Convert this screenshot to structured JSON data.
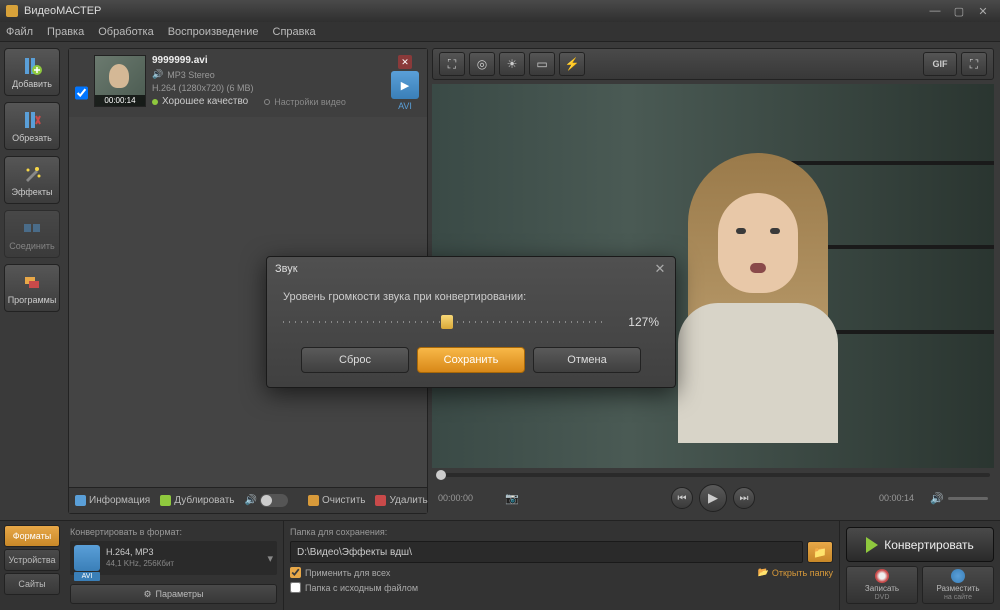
{
  "app_title": "ВидеоМАСТЕР",
  "menu": {
    "file": "Файл",
    "edit": "Правка",
    "process": "Обработка",
    "playback": "Воспроизведение",
    "help": "Справка"
  },
  "sidebar": {
    "add": "Добавить",
    "cut": "Обрезать",
    "effects": "Эффекты",
    "join": "Соединить",
    "programs": "Программы"
  },
  "file": {
    "name": "9999999.avi",
    "audio": "MP3 Stereo",
    "codec": "H.264 (1280x720) (6 MB)",
    "duration": "00:00:14",
    "quality": "Хорошее качество",
    "settings": "Настройки видео",
    "format": "AVI"
  },
  "list_actions": {
    "info": "Информация",
    "duplicate": "Дублировать",
    "clear": "Очистить",
    "delete": "Удалить"
  },
  "preview_tools": {
    "gif": "GIF"
  },
  "playback": {
    "start": "00:00:00",
    "end": "00:00:14"
  },
  "bottom_tabs": {
    "formats": "Форматы",
    "devices": "Устройства",
    "sites": "Сайты"
  },
  "format_panel": {
    "title": "Конвертировать в формат:",
    "name": "AVI",
    "details": "H.264, MP3",
    "specs": "44,1 KHz, 256Кбит",
    "params": "Параметры"
  },
  "save_panel": {
    "title": "Папка для сохранения:",
    "path": "D:\\Видео\\Эффекты вдш\\",
    "apply_all": "Применить для всех",
    "same_folder": "Папка с исходным файлом",
    "open_folder": "Открыть папку"
  },
  "actions": {
    "convert": "Конвертировать",
    "burn_dvd": "Записать",
    "dvd_sub": "DVD",
    "publish": "Разместить",
    "publish_sub": "на сайте"
  },
  "dialog": {
    "title": "Звук",
    "label": "Уровень громкости звука при конвертировании:",
    "value": "127%",
    "reset": "Сброс",
    "save": "Сохранить",
    "cancel": "Отмена"
  }
}
